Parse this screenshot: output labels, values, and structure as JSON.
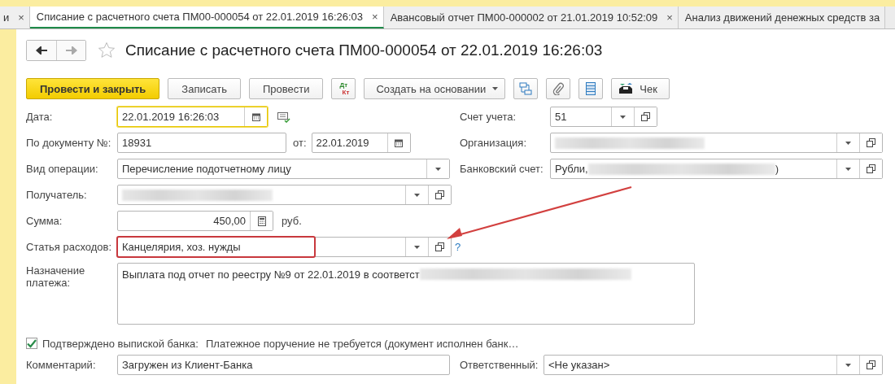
{
  "tabs": [
    {
      "label": "и",
      "close": "×",
      "selected": false
    },
    {
      "label": "Списание с расчетного счета ПМ00-000054 от 22.01.2019 16:26:03",
      "close": "×",
      "selected": true
    },
    {
      "label": "Авансовый отчет ПМ00-000002 от 21.01.2019 10:52:09",
      "close": "×",
      "selected": false
    },
    {
      "label": "Анализ движений денежных средств за",
      "selected": false
    }
  ],
  "title": "Списание с расчетного счета ПМ00-000054 от 22.01.2019 16:26:03",
  "favorite": false,
  "toolbar": [
    {
      "kind": "primary",
      "label": "Провести и закрыть"
    },
    {
      "kind": "plain",
      "label": "Записать"
    },
    {
      "kind": "plain",
      "label": "Провести"
    },
    {
      "kind": "dtkt",
      "label": "Дт",
      "label2": "Кт"
    },
    {
      "kind": "dropdown",
      "label": "Создать на основании"
    },
    {
      "kind": "structure"
    },
    {
      "kind": "clip"
    },
    {
      "kind": "list"
    },
    {
      "kind": "printer",
      "label": "Чек"
    }
  ],
  "rows": [
    {
      "left": [
        {
          "kind": "date",
          "label": "Дата:",
          "value": "22.01.2019 16:26:03",
          "focused": true
        },
        {
          "kind": "check-doc"
        }
      ],
      "right": {
        "kind": "reference",
        "label": "Счет учета:",
        "value": "51"
      }
    },
    {
      "left": [
        {
          "kind": "text",
          "label": "По документу №:",
          "value": "18931"
        },
        {
          "kind": "date",
          "side_label": "от:",
          "value": "22.01.2019"
        }
      ],
      "right": {
        "kind": "reference",
        "label": "Организация:",
        "redacted": true
      }
    },
    {
      "left": [
        {
          "kind": "choice",
          "label": "Вид операции:",
          "value": "Перечисление подотчетному лицу"
        }
      ],
      "right": {
        "kind": "reference",
        "label": "Банковский счет:",
        "value": "Рубли,",
        "redacted": true,
        "value_end": ")"
      }
    },
    {
      "left": [
        {
          "kind": "reference",
          "label": "Получатель:",
          "redacted": true
        }
      ]
    },
    {
      "left": [
        {
          "kind": "number",
          "label": "Сумма:",
          "value": "450,00",
          "unit": "руб."
        }
      ]
    },
    {
      "left": [
        {
          "kind": "reference",
          "label": "Статья расходов:",
          "value": "Канцелярия, хоз. нужды",
          "highlighted": true,
          "help": "?"
        }
      ]
    }
  ],
  "purpose": {
    "label": "Назначение платежа:",
    "value": "Выплата под отчет по реестру №9 от 22.01.2019 в соответст",
    "redacted": true
  },
  "bank": {
    "checked": true,
    "label": "Подтверждено выпиской банка:",
    "note": "Платежное поручение не требуется (документ исполнен банк…"
  },
  "comment": {
    "label": "Комментарий:",
    "value": "Загружен из Клиент-Банка"
  },
  "responsible": {
    "label": "Ответственный:",
    "value": "<Не указан>"
  }
}
